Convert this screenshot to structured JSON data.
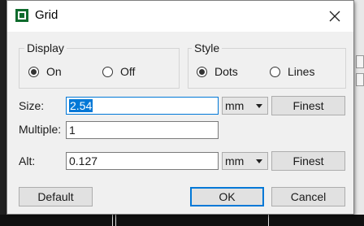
{
  "dialog": {
    "title": "Grid",
    "display": {
      "label": "Display",
      "on": "On",
      "off": "Off",
      "selected": "on"
    },
    "style": {
      "label": "Style",
      "dots": "Dots",
      "lines": "Lines",
      "selected": "dots"
    },
    "size": {
      "label": "Size:",
      "value": "2.54",
      "unit": "mm",
      "finest": "Finest"
    },
    "multiple": {
      "label": "Multiple:",
      "value": "1"
    },
    "alt": {
      "label": "Alt:",
      "value": "0.127",
      "unit": "mm",
      "finest": "Finest"
    },
    "buttons": {
      "default": "Default",
      "ok": "OK",
      "cancel": "Cancel"
    }
  },
  "colors": {
    "accent": "#0078d7",
    "icon": "#0f6b2d"
  },
  "icons": {
    "app": "grid-app-icon",
    "close": "close-icon"
  }
}
